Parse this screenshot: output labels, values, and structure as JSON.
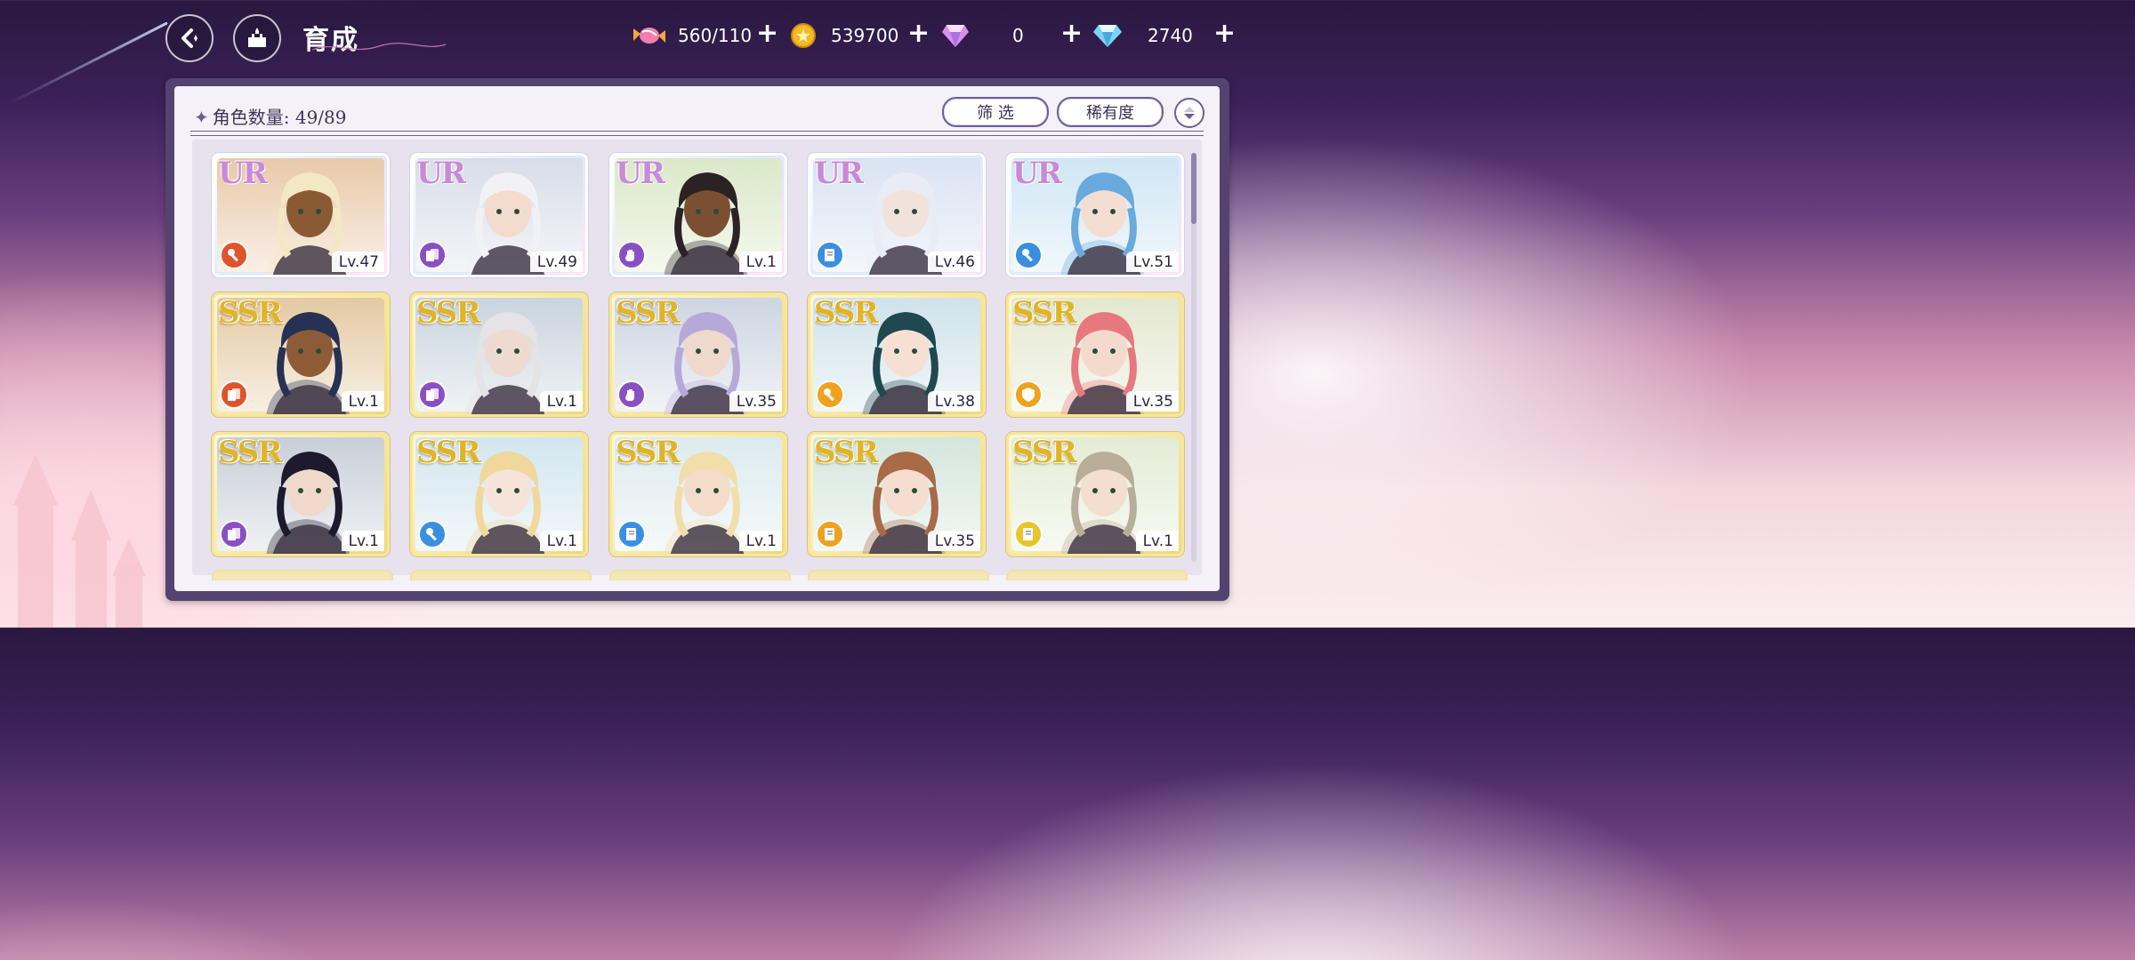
{
  "header": {
    "title": "育成",
    "back_label": "back",
    "home_label": "home"
  },
  "currencies": [
    {
      "icon": "candy-icon",
      "value": "560/110"
    },
    {
      "icon": "gold-coin-icon",
      "value": "539700"
    },
    {
      "icon": "pink-gem-icon",
      "value": "0"
    },
    {
      "icon": "blue-diamond-icon",
      "value": "2740"
    }
  ],
  "panel": {
    "count_label": "角色数量: 49/89",
    "filter_label": "筛 选",
    "rarity_sort_label": "稀有度"
  },
  "attr_colors": {
    "red": "#e0542b",
    "purple": "#8b4fc4",
    "blue": "#3a8fe0",
    "orange": "#eea21d",
    "yellow": "#e8c52b"
  },
  "cards": [
    {
      "rarity": "UR",
      "level": "Lv.47",
      "attr": "red",
      "attr_icon": "key-icon",
      "bg": "#e9c9a8",
      "hair": "#f4e7c4",
      "skin": "#8a5a35"
    },
    {
      "rarity": "UR",
      "level": "Lv.49",
      "attr": "purple",
      "attr_icon": "cards-icon",
      "bg": "#d8dde8",
      "hair": "#f2f2f6",
      "skin": "#f3dccd"
    },
    {
      "rarity": "UR",
      "level": "Lv.1",
      "attr": "purple",
      "attr_icon": "glove-icon",
      "bg": "#dbe8c8",
      "hair": "#2b2226",
      "skin": "#7c4f33"
    },
    {
      "rarity": "UR",
      "level": "Lv.46",
      "attr": "blue",
      "attr_icon": "book-icon",
      "bg": "#d9e3f1",
      "hair": "#e9ecf5",
      "skin": "#f2e2dc"
    },
    {
      "rarity": "UR",
      "level": "Lv.51",
      "attr": "blue",
      "attr_icon": "key-icon",
      "bg": "#cfe6f4",
      "hair": "#69a9de",
      "skin": "#f4ded2"
    },
    {
      "rarity": "SSR",
      "level": "Lv.1",
      "attr": "red",
      "attr_icon": "cards-icon",
      "bg": "#e4c9a3",
      "hair": "#273154",
      "skin": "#8e5b38"
    },
    {
      "rarity": "SSR",
      "level": "Lv.1",
      "attr": "purple",
      "attr_icon": "cards-icon",
      "bg": "#c9d4de",
      "hair": "#e5e3e6",
      "skin": "#eedad0"
    },
    {
      "rarity": "SSR",
      "level": "Lv.35",
      "attr": "purple",
      "attr_icon": "glove-icon",
      "bg": "#cdd5e1",
      "hair": "#b6a9d8",
      "skin": "#efd8cc"
    },
    {
      "rarity": "SSR",
      "level": "Lv.38",
      "attr": "orange",
      "attr_icon": "key-icon",
      "bg": "#cfe2ea",
      "hair": "#1f4850",
      "skin": "#f6e0d3"
    },
    {
      "rarity": "SSR",
      "level": "Lv.35",
      "attr": "orange",
      "attr_icon": "shield-icon",
      "bg": "#e3e8cf",
      "hair": "#e7787e",
      "skin": "#f4dacd"
    },
    {
      "rarity": "SSR",
      "level": "Lv.1",
      "attr": "purple",
      "attr_icon": "cards-icon",
      "bg": "#c8cfd8",
      "hair": "#1c1a2c",
      "skin": "#f0d9cb"
    },
    {
      "rarity": "SSR",
      "level": "Lv.1",
      "attr": "blue",
      "attr_icon": "key-icon",
      "bg": "#d2e6ef",
      "hair": "#f0d79c",
      "skin": "#f6e3da"
    },
    {
      "rarity": "SSR",
      "level": "Lv.1",
      "attr": "blue",
      "attr_icon": "book-icon",
      "bg": "#dcebef",
      "hair": "#f2deaa",
      "skin": "#f3dcc9"
    },
    {
      "rarity": "SSR",
      "level": "Lv.35",
      "attr": "orange",
      "attr_icon": "book-icon",
      "bg": "#d4e6dd",
      "hair": "#a86a47",
      "skin": "#f5ddd0"
    },
    {
      "rarity": "SSR",
      "level": "Lv.1",
      "attr": "yellow",
      "attr_icon": "book-icon",
      "bg": "#e3ecd6",
      "hair": "#b8ad98",
      "skin": "#f3ded0"
    }
  ]
}
